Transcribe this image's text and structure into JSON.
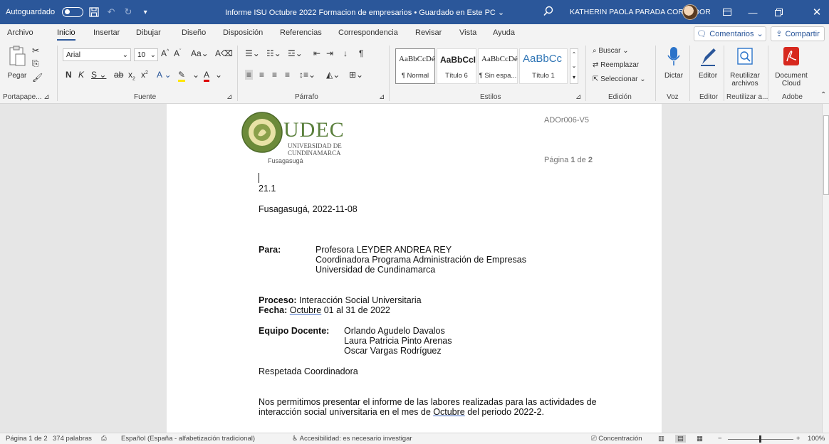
{
  "titlebar": {
    "autosave_label": "Autoguardado",
    "document_title": "Informe ISU Octubre 2022 Formacion de empresarios • Guardado en Este PC",
    "user_name": "KATHERIN PAOLA PARADA CORREDOR",
    "accent_color": "#2b579a"
  },
  "menu": {
    "tabs": [
      "Archivo",
      "Inicio",
      "Insertar",
      "Dibujar",
      "Diseño",
      "Disposición",
      "Referencias",
      "Correspondencia",
      "Revisar",
      "Vista",
      "Ayuda"
    ],
    "active_tab": "Inicio",
    "comments_label": "Comentarios",
    "share_label": "Compartir"
  },
  "ribbon": {
    "paste_label": "Pegar",
    "font_name": "Arial",
    "font_size": "10",
    "groups": [
      "Portapape...",
      "Fuente",
      "Párrafo",
      "Estilos",
      "Edición",
      "Voz",
      "Editor",
      "Reutilizar a...",
      "Adobe"
    ],
    "styles": [
      {
        "sample": "AaBbCcDé",
        "name": "¶ Normal"
      },
      {
        "sample": "AaBbCcI",
        "name": "Título 6"
      },
      {
        "sample": "AaBbCcDé",
        "name": "¶ Sin espa..."
      },
      {
        "sample": "AaBbCc",
        "name": "Título 1"
      }
    ],
    "editing": {
      "find": "Buscar",
      "replace": "Reemplazar",
      "select": "Seleccionar"
    },
    "dictate_label": "Dictar",
    "editor_label": "Editor",
    "reuse_label_1": "Reutilizar",
    "reuse_label_2": "archivos",
    "adobe_label_1": "Document",
    "adobe_label_2": "Cloud"
  },
  "document": {
    "header_code": "ADOr006-V5",
    "logo_title": "UDEC",
    "logo_line1": "UNIVERSIDAD DE",
    "logo_line2": "CUNDINAMARCA",
    "logo_city": "Fusagasugá",
    "page_label": "Página",
    "page_current": "1",
    "page_of": "de",
    "page_total": "2",
    "ref_number": "21.1",
    "place_date": "Fusagasugá, 2022-11-08",
    "para_label": "Para:",
    "recipient": [
      "Profesora LEYDER ANDREA REY",
      "Coordinadora Programa Administración de Empresas",
      "Universidad de Cundinamarca"
    ],
    "process_label": "Proceso:",
    "process_value": " Interacción Social Universitaria",
    "date_label": "Fecha:",
    "date_month": "Octubre",
    "date_rest": " 01 al 31 de 2022",
    "team_label": "Equipo Docente:",
    "team": [
      "Orlando Agudelo Davalos",
      "Laura Patricia Pinto Arenas",
      "Oscar Vargas Rodríguez"
    ],
    "salutation": "Respetada Coordinadora",
    "body_line1": "Nos permitimos presentar el informe de las labores realizadas para las actividades de",
    "body_line2_a": "interacción social universitaria en el mes de ",
    "body_line2_month": "Octubre",
    "body_line2_b": " del periodo 2022-2."
  },
  "status": {
    "page": "Página 1 de 2",
    "words": "374 palabras",
    "language": "Español (España - alfabetización tradicional)",
    "accessibility": "Accesibilidad: es necesario investigar",
    "focus": "Concentración",
    "zoom": "100%"
  }
}
